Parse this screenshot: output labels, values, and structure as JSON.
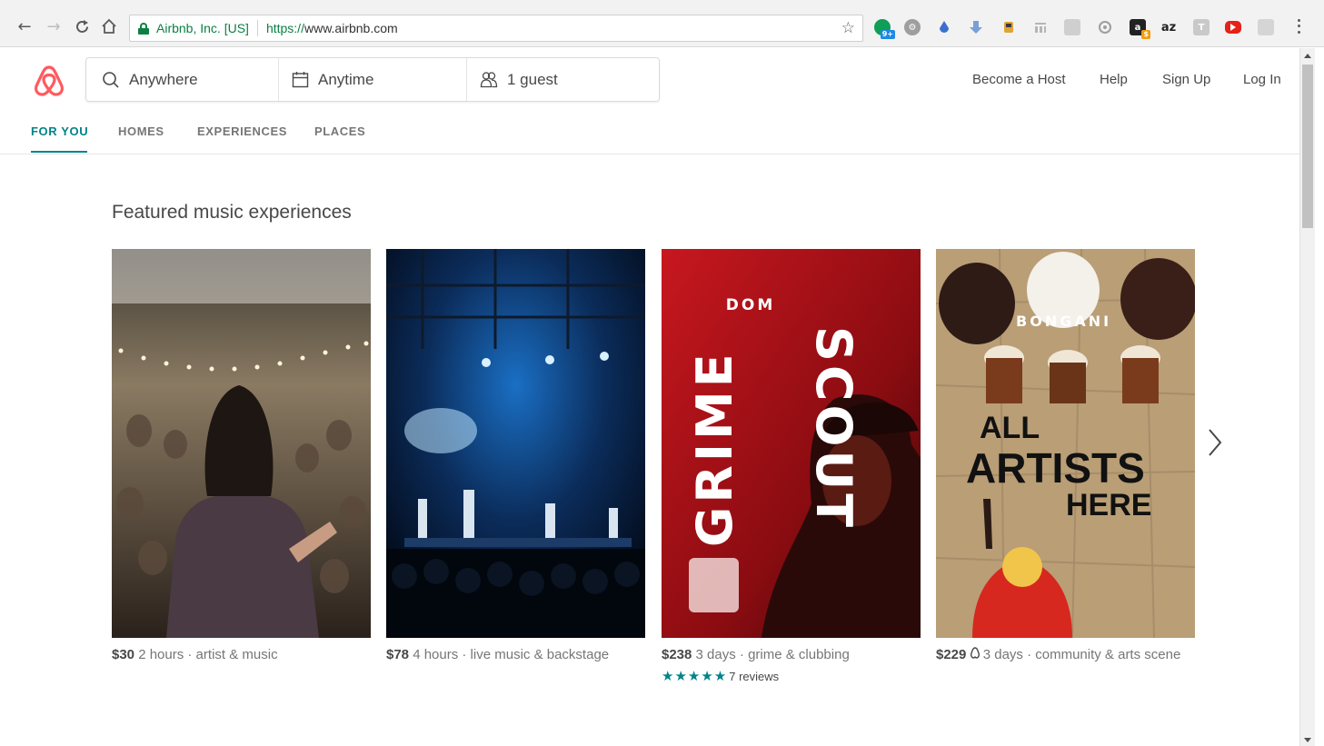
{
  "browser": {
    "cert_label": "Airbnb, Inc. [US]",
    "url_scheme": "https://",
    "url_host": "www.airbnb.com",
    "extensions": [
      "green-circle-ext",
      "settings-ext",
      "blue-drop-ext",
      "download-ext",
      "hand-ext",
      "reader-ext",
      "image-ext",
      "circle-ext",
      "amazon-ext",
      "az-ext",
      "t-ext",
      "youtube-ext",
      "pdf-ext"
    ],
    "ext_badge_1": "9+",
    "ext_label_az": "az",
    "ext_label_t": "T",
    "ext_label_a": "a"
  },
  "site": {
    "brand_color": "#FF5A5F",
    "accent_color": "#008489",
    "search": {
      "where": "Anywhere",
      "when": "Anytime",
      "guests": "1 guest"
    },
    "header_links": [
      "Become a Host",
      "Help",
      "Sign Up",
      "Log In"
    ],
    "tabs": [
      "FOR YOU",
      "HOMES",
      "EXPERIENCES",
      "PLACES"
    ],
    "active_tab": "FOR YOU"
  },
  "section": {
    "title": "Featured music experiences",
    "cards": [
      {
        "price": "$30",
        "details": " 2 hours · artist & music"
      },
      {
        "price": "$78",
        "details": " 4 hours · live music & backstage"
      },
      {
        "price": "$238",
        "details": " 3 days · grime & clubbing",
        "stars": "★★★★★",
        "reviews": "7 reviews",
        "rating": 5,
        "poster": {
          "top": "DOM",
          "left": "GRIME",
          "right": "SCOUT"
        }
      },
      {
        "price": "$229",
        "details": " 3 days · community & arts scene",
        "poster": {
          "top": "BONGANI",
          "line1": "ALL",
          "line2": "ARTISTS",
          "line3": "HERE"
        }
      }
    ]
  }
}
